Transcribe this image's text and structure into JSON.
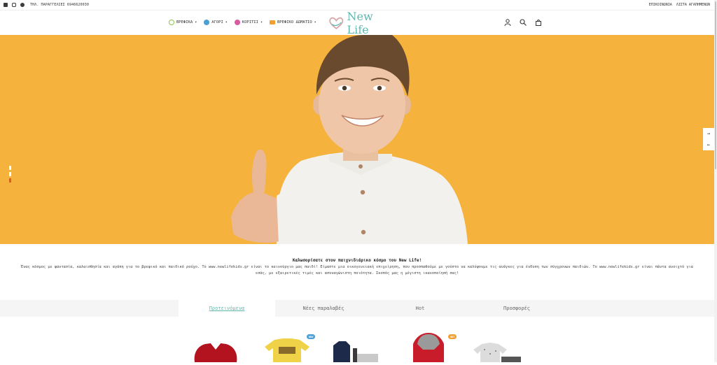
{
  "topbar": {
    "phone": "ΤΗΛ. ΠΑΡΑΓΓΕΛΙΕΣ 6946620030",
    "links": [
      "ΕΠΙΚΟΙΝΩΝΙΑ",
      "ΛΙΣΤΑ ΑΓΑΠΗΜΕΝΩΝ"
    ]
  },
  "nav": {
    "items": [
      {
        "label": "ΒΡΕΦΙΚΑ",
        "icon": "baby-icon",
        "color": "#8bc34a"
      },
      {
        "label": "ΑΓΟΡΙ",
        "icon": "boy-icon",
        "color": "#4a9fd4"
      },
      {
        "label": "ΚΟΡΙΤΣΙ",
        "icon": "girl-icon",
        "color": "#d95a9f"
      },
      {
        "label": "ΒΡΕΦΙΚΟ ΔΩΜΑΤΙΟ",
        "icon": "crib-icon",
        "color": "#f0a030"
      }
    ],
    "caret": "▾"
  },
  "logo": {
    "text": "New Life",
    "color": "#5fb8b0"
  },
  "hero": {
    "background": "#f5b23c",
    "slides": 3,
    "active_slide": 2
  },
  "welcome": {
    "title": "Καλωσορίσατε στον παιχνιδιάρικο κόσμο του New Life!",
    "text": "Ένας κόσμος με φαντασία, καλαισθησία και αγάπη για το βρεφικό και παιδικό ρούχο. Το www.newlifekids.gr είναι το καινούργιο μας παιδί! Είμαστε μια οικογενειακή επιχείρηση, που προσπαθούμε με γούστο να καλύψουμε τις ανάγκες για ένδυση των σύγχρονων παιδιών. Το www.newlifekids.gr είναι πάντα ανοιχτό για εσάς, με εξαιρετικές τιμές και ασυναγώνιστη ποιότητα. Σκοπός μας η μέγιστη ικανοποίησή σας!"
  },
  "tabs": [
    {
      "label": "Προτεινόμενα",
      "active": true
    },
    {
      "label": "Νέες παραλαβές",
      "active": false
    },
    {
      "label": "Hot",
      "active": false
    },
    {
      "label": "Προσφορές",
      "active": false
    }
  ],
  "products": [
    {
      "name": "red-sweater",
      "badge": ""
    },
    {
      "name": "yellow-tshirt",
      "badge": "NEW"
    },
    {
      "name": "navy-vest-set",
      "badge": ""
    },
    {
      "name": "red-grey-hoodie",
      "badge": "HOT"
    },
    {
      "name": "printed-shirt-set",
      "badge": ""
    }
  ],
  "badges": {
    "new_color": "#4a9fd4",
    "hot_color": "#f0a030"
  }
}
